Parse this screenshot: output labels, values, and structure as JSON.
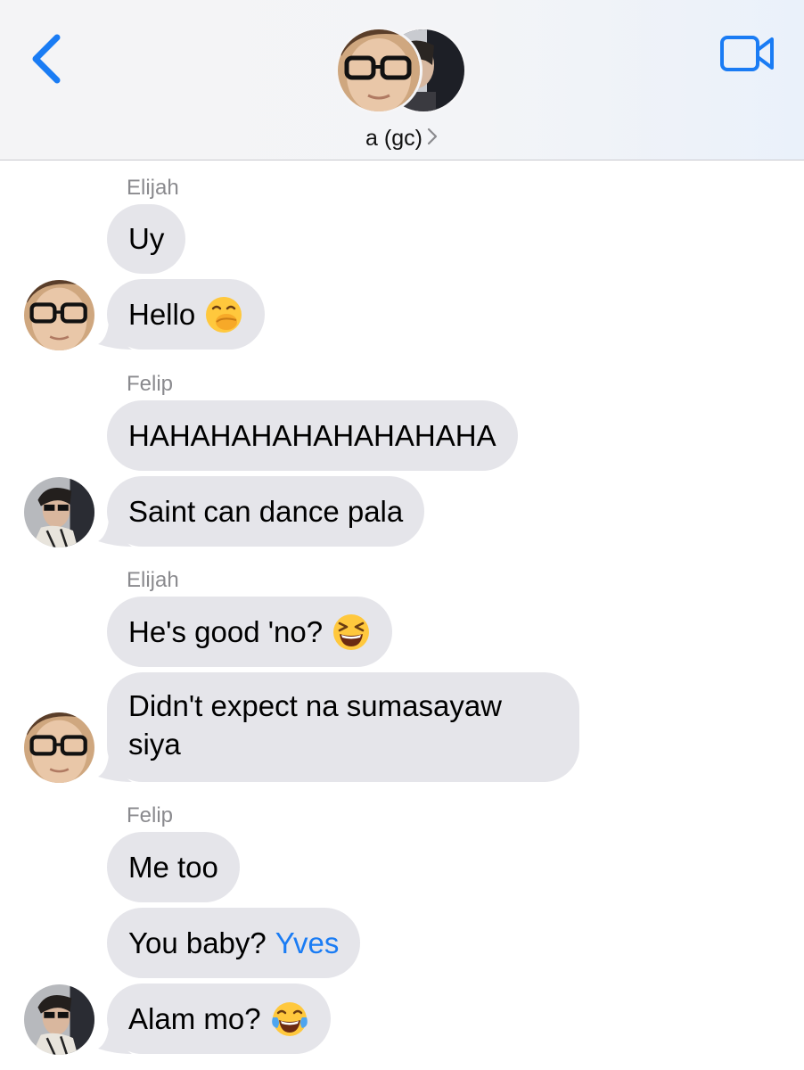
{
  "header": {
    "title": "a (gc)",
    "back_icon": "chevron-left-icon",
    "video_icon": "video-camera-icon",
    "accent_color": "#1a7cf4"
  },
  "messages": [
    {
      "sender": "Elijah",
      "text": "Uy"
    },
    {
      "text": "Hello",
      "emoji": "face-with-hand-over-mouth"
    },
    {
      "sender": "Felip",
      "text": "HAHAHAHAHAHAHAHAHA"
    },
    {
      "text": "Saint can dance pala"
    },
    {
      "sender": "Elijah",
      "text": "He's good 'no?",
      "emoji": "grinning-squinting-face"
    },
    {
      "text": "Didn't expect na sumasayaw siya"
    },
    {
      "sender": "Felip",
      "text": "Me too"
    },
    {
      "text": "You baby?",
      "mention": "Yves"
    },
    {
      "text": "Alam mo?",
      "emoji": "face-with-tears-of-joy"
    }
  ],
  "colors": {
    "bubble": "#e5e5ea",
    "sender_name": "#8a8a8e",
    "mention": "#1a7cf4"
  }
}
